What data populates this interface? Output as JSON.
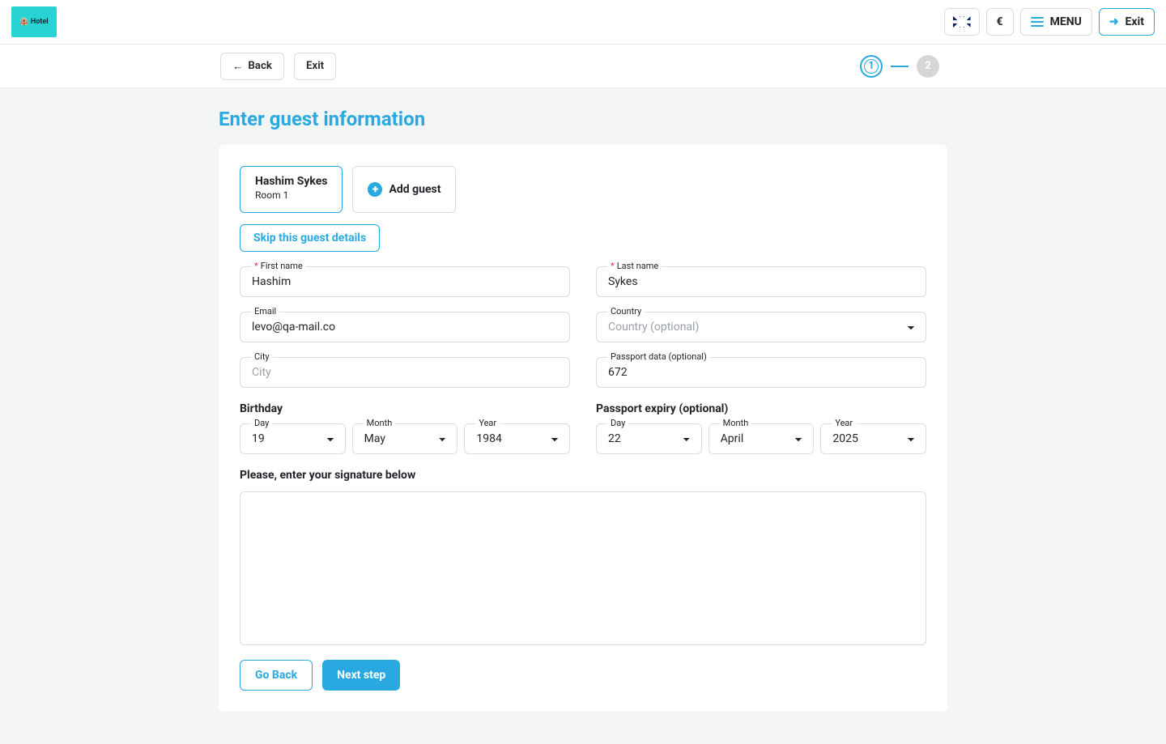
{
  "brand": "Hotel",
  "topbar": {
    "currency": "€",
    "menu_label": "MENU",
    "exit_label": "Exit"
  },
  "subbar": {
    "back_label": "Back",
    "exit_label": "Exit",
    "steps": {
      "current": "1",
      "next": "2"
    }
  },
  "page": {
    "title": "Enter guest information"
  },
  "guest_tabs": {
    "active": {
      "name": "Hashim Sykes",
      "room": "Room 1"
    },
    "add_label": "Add guest"
  },
  "skip_label": "Skip this guest details",
  "fields": {
    "first_name": {
      "label": "First name",
      "value": "Hashim",
      "required": true
    },
    "last_name": {
      "label": "Last name",
      "value": "Sykes",
      "required": true
    },
    "email": {
      "label": "Email",
      "value": "levo@qa-mail.co"
    },
    "country": {
      "label": "Country",
      "placeholder": "Country (optional)"
    },
    "city": {
      "label": "City",
      "placeholder": "City",
      "value": ""
    },
    "passport": {
      "label": "Passport data (optional)",
      "value": "672"
    }
  },
  "birthday": {
    "group_label": "Birthday",
    "day": {
      "label": "Day",
      "value": "19"
    },
    "month": {
      "label": "Month",
      "value": "May"
    },
    "year": {
      "label": "Year",
      "value": "1984"
    }
  },
  "expiry": {
    "group_label": "Passport expiry (optional)",
    "day": {
      "label": "Day",
      "value": "22"
    },
    "month": {
      "label": "Month",
      "value": "April"
    },
    "year": {
      "label": "Year",
      "value": "2025"
    }
  },
  "signature_label": "Please, enter your signature below",
  "footer": {
    "go_back": "Go Back",
    "next": "Next step"
  }
}
